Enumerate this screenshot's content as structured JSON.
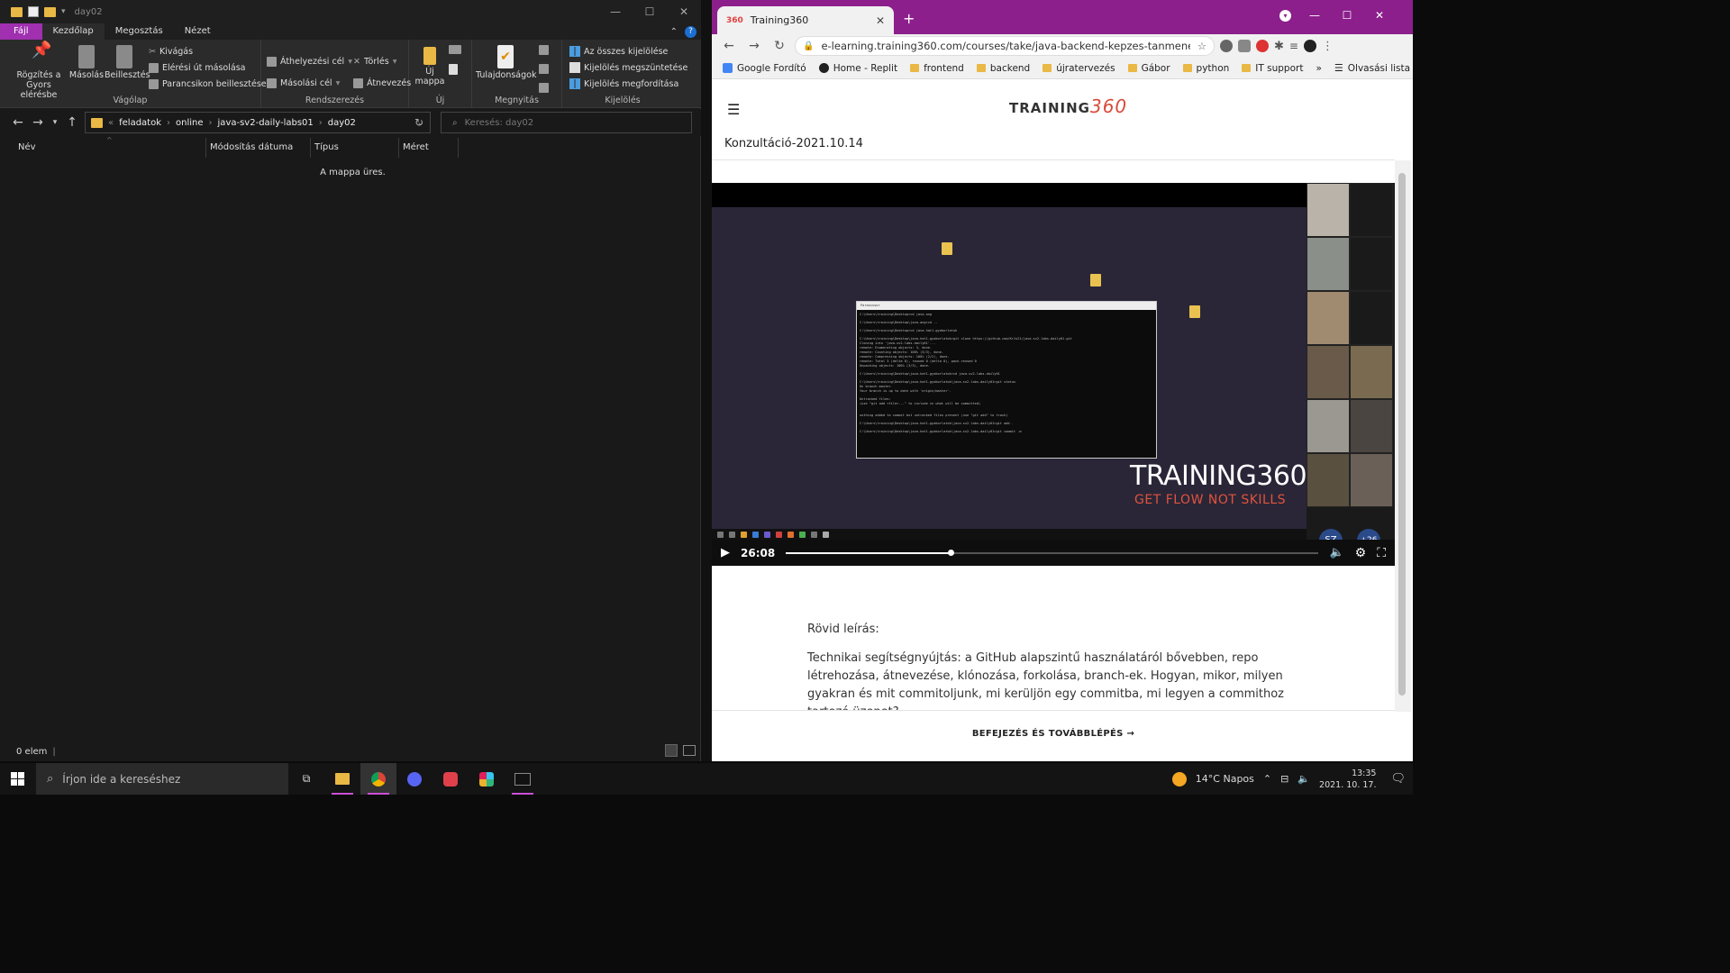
{
  "explorer": {
    "title": "day02",
    "tabs": [
      "Fájl",
      "Kezdőlap",
      "Megosztás",
      "Nézet"
    ],
    "ribbon": {
      "clipboard": {
        "label": "Vágólap",
        "pin": "Rögzítés a Gyors elérésbe",
        "copy": "Másolás",
        "paste": "Beillesztés",
        "cut": "Kivágás",
        "copy_path": "Elérési út másolása",
        "paste_shortcut": "Parancsikon beillesztése"
      },
      "organize": {
        "label": "Rendszerezés",
        "move_to": "Áthelyezési cél",
        "copy_to": "Másolási cél",
        "delete": "Törlés",
        "rename": "Átnevezés"
      },
      "new": {
        "label": "Új",
        "new_folder": "Új mappa"
      },
      "open": {
        "label": "Megnyitás",
        "properties": "Tulajdonságok"
      },
      "select": {
        "label": "Kijelölés",
        "select_all": "Az összes kijelölése",
        "select_none": "Kijelölés megszüntetése",
        "invert": "Kijelölés megfordítása"
      }
    },
    "breadcrumb": [
      "feladatok",
      "online",
      "java-sv2-daily-labs01",
      "day02"
    ],
    "search_placeholder": "Keresés: day02",
    "columns": [
      "Név",
      "Módosítás dátuma",
      "Típus",
      "Méret"
    ],
    "empty_message": "A mappa üres.",
    "status": "0 elem"
  },
  "chrome": {
    "tab_title": "Training360",
    "tab_favicon": "360",
    "url": "e-learning.training360.com/courses/take/java-backend-kepzes-tanmenet-sv-asz-2-...",
    "bookmarks": [
      "Google Fordító",
      "Home - Replit",
      "frontend",
      "backend",
      "újratervezés",
      "Gábor",
      "python",
      "IT support"
    ],
    "reading_list": "Olvasási lista",
    "logo_text": "TRAINING",
    "logo_num": "360",
    "lesson_title": "Konzultáció-2021.10.14",
    "video": {
      "brand": "TRAINING360",
      "slogan": "GET FLOW NOT SKILLS",
      "time": "26:08",
      "progress": 0.31,
      "participant_badges": [
        "SZ",
        "+26"
      ],
      "terminal_title": "Parancssor",
      "terminal_lines": [
        "C:\\Users\\training\\Desktop>cd java-ang",
        "C:\\Users\\training\\Desktop\\java-ang>cd ..",
        "C:\\Users\\training\\Desktop>cd java-hat1-gyakorlatok",
        "C:\\Users\\training\\Desktop\\java-hat1-gyakorlatok>git clone https://github.com/Kr1s21/java-sv2-labs-daily01.git",
        "Cloning into 'java-sv2-labs-daily01'...",
        "remote: Enumerating objects: 3, done.",
        "remote: Counting objects: 100% (3/3), done.",
        "remote: Compressing objects: 100% (2/2), done.",
        "remote: Total 3 (delta 0), reused 0 (delta 0), pack-reused 0",
        "Unpacking objects: 100% (3/3), done.",
        "C:\\Users\\training\\Desktop\\java-hat1-gyakorlatok>cd java-sv2-labs-daily01",
        "C:\\Users\\training\\Desktop\\java-hat1-gyakorlatok\\java-sv2-labs-daily01>git status",
        "On branch master",
        "Your branch is up to date with 'origin/master'.",
        "Untracked files:",
        "  (use \"git add <file>...\" to include in what will be committed)",
        "nothing added to commit but untracked files present (use \"git add\" to track)",
        "C:\\Users\\training\\Desktop\\java-hat1-gyakorlatok\\java-sv2-labs-daily01>git add .",
        "C:\\Users\\training\\Desktop\\java-hat1-gyakorlatok\\java-sv2-labs-daily01>git commit -m"
      ]
    },
    "description_title": "Rövid leírás:",
    "description_text": "Technikai segítségnyújtás: a GitHub alapszintű használatáról bővebben, repo létrehozása, átnevezése, klónozása, forkolása, branch-ek. Hogyan, mikor, milyen gyakran és mit commitoljunk, mi kerüljön egy commitba, mi legyen a commithoz tartozó üzenet?",
    "footer_action": "BEFEJEZÉS ÉS TOVÁBBLÉPÉS →"
  },
  "taskbar": {
    "search_placeholder": "Írjon ide a kereséshez",
    "weather": "14°C  Napos",
    "time": "13:35",
    "date": "2021. 10. 17."
  },
  "colors": {
    "accent": "#8c1f8c",
    "file_tab": "#a030b0",
    "brand_red": "#e0533c",
    "folder": "#e9b845"
  },
  "icons": [
    "folder-icon",
    "checkbox-icon",
    "pin-icon",
    "copy-icon",
    "paste-icon",
    "scissors-icon",
    "back-arrow-icon",
    "forward-arrow-icon",
    "up-arrow-icon",
    "refresh-icon",
    "search-icon",
    "star-icon",
    "puzzle-icon",
    "play-icon",
    "volume-icon",
    "settings-icon",
    "fullscreen-icon",
    "windows-icon",
    "sun-icon"
  ]
}
